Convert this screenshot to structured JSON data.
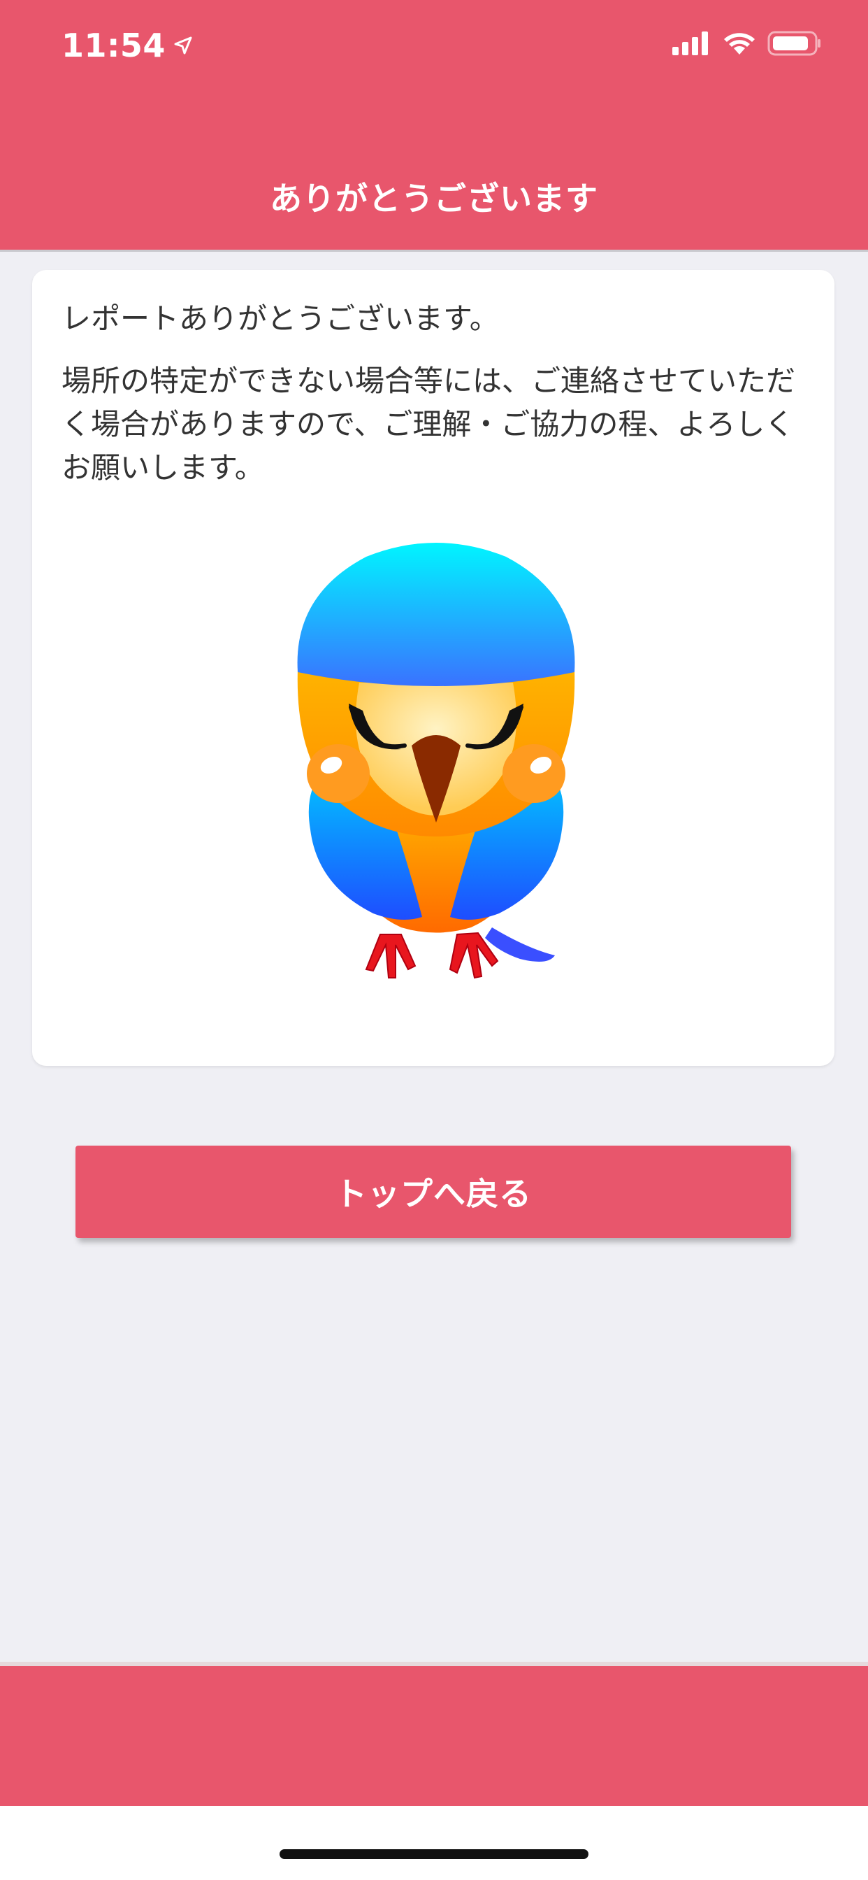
{
  "status_bar": {
    "time": "11:54",
    "location_icon": "location-arrow-icon",
    "signal_icon": "cellular-signal-icon",
    "wifi_icon": "wifi-icon",
    "battery_icon": "battery-icon"
  },
  "nav": {
    "title": "ありがとうございます"
  },
  "card": {
    "line1": "レポートありがとうございます。",
    "paragraph": "場所の特定ができない場合等には、ご連絡させていただく場合がありますので、ご理解・ご協力の程、よろしくお願いします。",
    "illustration": "bowing-bird-mascot"
  },
  "button": {
    "label": "トップへ戻る"
  },
  "colors": {
    "brand": "#e8566c",
    "background": "#efeff4",
    "card": "#ffffff",
    "text": "#333333"
  }
}
